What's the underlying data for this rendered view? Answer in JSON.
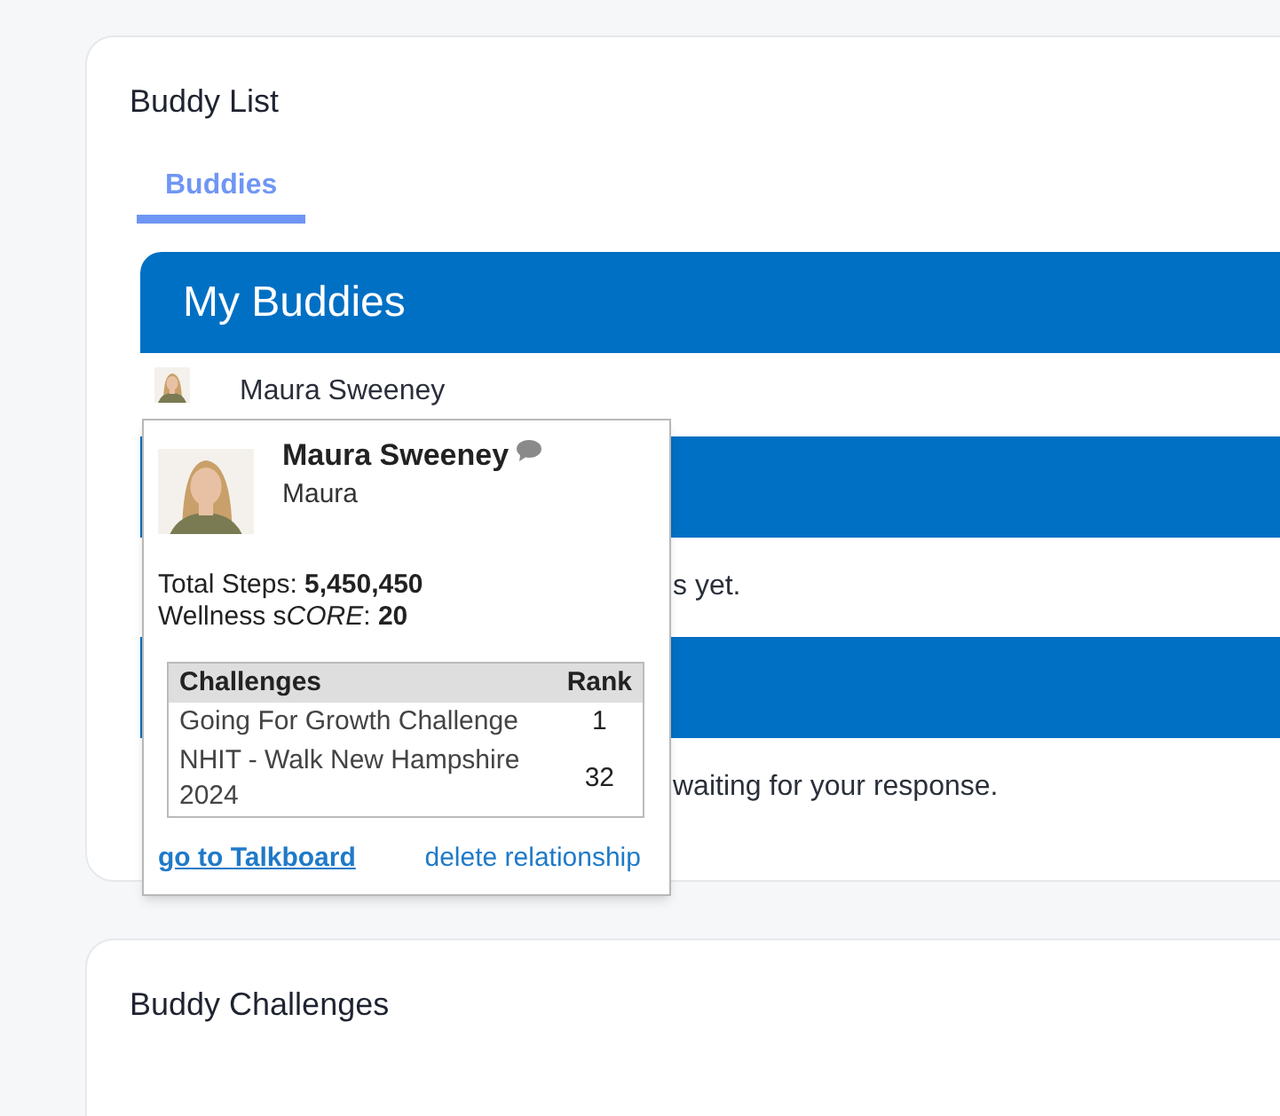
{
  "card": {
    "title": "Buddy List"
  },
  "tabs": [
    {
      "label": "Buddies",
      "selected": true
    }
  ],
  "sections": [
    {
      "heading": "My Buddies",
      "rows": [
        {
          "kind": "buddy",
          "name": "Maura Sweeney"
        }
      ]
    },
    {
      "rows": [
        {
          "kind": "note",
          "text": "s yet."
        }
      ]
    },
    {
      "rows": [
        {
          "kind": "note",
          "text": "waiting for your response."
        }
      ]
    }
  ],
  "popup": {
    "name": "Maura Sweeney",
    "nickname": "Maura",
    "stats": [
      {
        "label": "Total Steps: ",
        "value": "5,450,450"
      },
      {
        "label": "Wellness s",
        "label_italic": "CORE",
        "label_end": ": ",
        "value": "20"
      }
    ],
    "table": {
      "columns": [
        "Challenges",
        "Rank"
      ],
      "rows": [
        [
          "Going For Growth Challenge",
          "1"
        ],
        [
          "NHIT - Walk New Hampshire 2024",
          "32"
        ]
      ]
    },
    "links": [
      "go to Talkboard",
      "delete relationship"
    ]
  },
  "second_card": {
    "title": "Buddy Challenges"
  }
}
